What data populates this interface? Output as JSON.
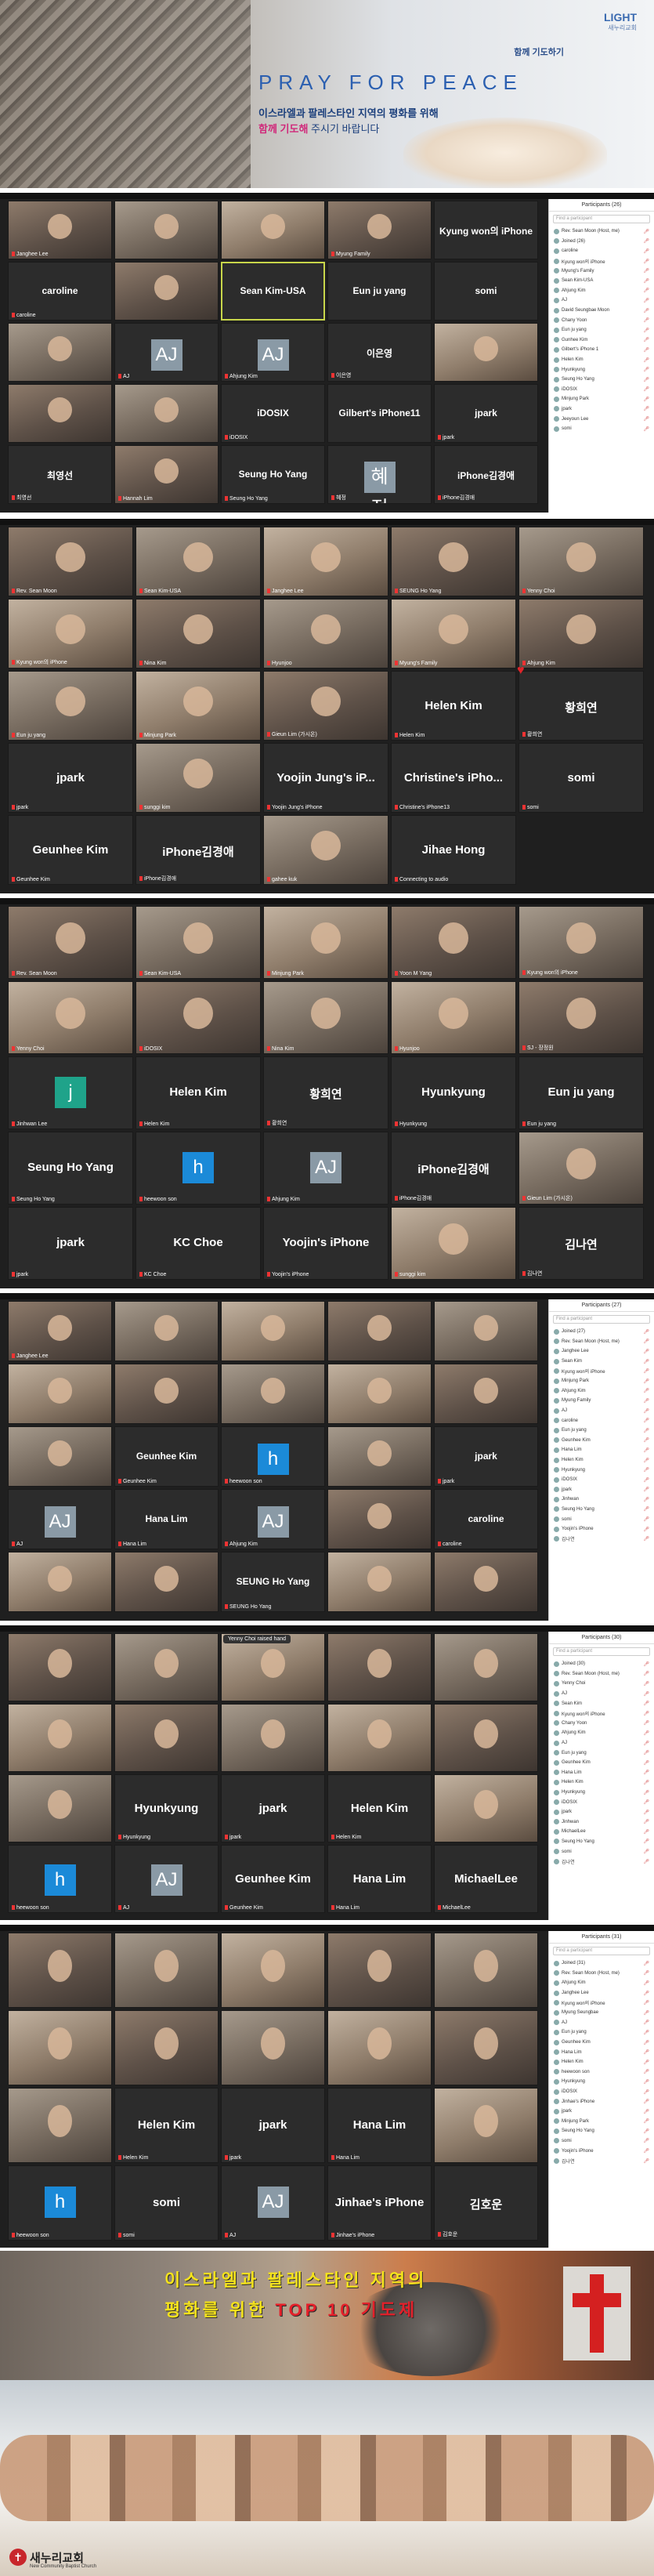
{
  "banner": {
    "logo": "LIGHT",
    "logo_sub": "새누리교회",
    "pray_together": "함께 기도하기",
    "title_pre": "PRAY FOR ",
    "title_word": "PEACE",
    "subtitle1": "이스라엘과 팔레스타인 지역의 평화를 위해",
    "subtitle2_highlight": "함께 기도해",
    "subtitle2_rest": " 주시기 바랍니다"
  },
  "screen1": {
    "tiles": [
      {
        "name": "Janghee Lee",
        "big": ""
      },
      {
        "name": "",
        "big": ""
      },
      {
        "name": "",
        "big": ""
      },
      {
        "name": "Myung Family",
        "big": ""
      },
      {
        "name": "",
        "big": "Kyung won의 iPhone"
      },
      {
        "name": "caroline",
        "big": "caroline"
      },
      {
        "name": "",
        "big": ""
      },
      {
        "name": "",
        "big": "Sean Kim-USA"
      },
      {
        "name": "",
        "big": "Eun ju yang"
      },
      {
        "name": "",
        "big": "somi"
      },
      {
        "name": "",
        "big": ""
      },
      {
        "name": "AJ",
        "big": "AJ"
      },
      {
        "name": "Ahjung Kim",
        "big": "AJ"
      },
      {
        "name": "이은영",
        "big": "이은영"
      },
      {
        "name": "",
        "big": ""
      },
      {
        "name": "",
        "big": ""
      },
      {
        "name": "",
        "big": ""
      },
      {
        "name": "iDOSIX",
        "big": "iDOSIX"
      },
      {
        "name": "",
        "big": "Gilbert's iPhone11"
      },
      {
        "name": "jpark",
        "big": "jpark"
      },
      {
        "name": "최영선",
        "big": "최영선"
      },
      {
        "name": "Hannah Lim",
        "big": ""
      },
      {
        "name": "Seung Ho Yang",
        "big": "Seung Ho Yang"
      },
      {
        "name": "혜정",
        "big": "혜정"
      },
      {
        "name": "iPhone김경애",
        "big": "iPhone김경애"
      }
    ],
    "panel_title": "Participants (26)",
    "search": "Find a participant",
    "participants": [
      "Rev. Sean Moon (Host, me)",
      "Joined (26)",
      "caroline",
      "Kyung won의 iPhone",
      "Myung's Family",
      "Sean Kim-USA",
      "Ahjung Kim",
      "AJ",
      "David Seungbae Moon",
      "Chany Yoon",
      "Eun ju yang",
      "Gunhee Kim",
      "Gilbert's iPhone 1",
      "Helen Kim",
      "Hyunkyung",
      "Seung Ho Yang",
      "iDOSIX",
      "Minjung Park",
      "jpark",
      "Jeeyoun Lee",
      "somi"
    ]
  },
  "screen2": {
    "tiles": [
      {
        "name": "Rev. Sean Moon",
        "big": ""
      },
      {
        "name": "Sean Kim-USA",
        "big": ""
      },
      {
        "name": "Janghee Lee",
        "big": ""
      },
      {
        "name": "SEUNG Ho Yang",
        "big": ""
      },
      {
        "name": "Yenny Choi",
        "big": ""
      },
      {
        "name": "Kyung won의 iPhone",
        "big": ""
      },
      {
        "name": "Nina Kim",
        "big": ""
      },
      {
        "name": "Hyunjoo",
        "big": ""
      },
      {
        "name": "Myung's Family",
        "big": ""
      },
      {
        "name": "Ahjung Kim",
        "big": ""
      },
      {
        "name": "Eun ju yang",
        "big": ""
      },
      {
        "name": "Minjung Park",
        "big": ""
      },
      {
        "name": "Gieun Lim (가시온)",
        "big": ""
      },
      {
        "name": "Helen Kim",
        "big": "Helen Kim"
      },
      {
        "name": "황희연",
        "big": "황희연"
      },
      {
        "name": "jpark",
        "big": "jpark"
      },
      {
        "name": "sunggi kim",
        "big": ""
      },
      {
        "name": "Yoojin Jung's iPhone",
        "big": "Yoojin Jung's iP..."
      },
      {
        "name": "Christine's iPhone13",
        "big": "Christine's iPho..."
      },
      {
        "name": "somi",
        "big": "somi"
      },
      {
        "name": "Geunhee Kim",
        "big": "Geunhee Kim"
      },
      {
        "name": "iPhone김경애",
        "big": "iPhone김경애"
      },
      {
        "name": "gahee kuk",
        "big": ""
      },
      {
        "name": "Connecting to audio",
        "big": "Jihae Hong"
      }
    ]
  },
  "screen3": {
    "tiles": [
      {
        "name": "Rev. Sean Moon",
        "big": ""
      },
      {
        "name": "Sean Kim-USA",
        "big": ""
      },
      {
        "name": "Minjung Park",
        "big": ""
      },
      {
        "name": "Yoon M Yang",
        "big": ""
      },
      {
        "name": "Kyung won의 iPhone",
        "big": ""
      },
      {
        "name": "Yenny Choi",
        "big": ""
      },
      {
        "name": "iDOSIX",
        "big": ""
      },
      {
        "name": "Nina Kim",
        "big": ""
      },
      {
        "name": "Hyunjoo",
        "big": ""
      },
      {
        "name": "SJ - 장정원",
        "big": ""
      },
      {
        "name": "Jinhwan Lee",
        "big": "j"
      },
      {
        "name": "Helen Kim",
        "big": "Helen Kim"
      },
      {
        "name": "황희연",
        "big": "황희연"
      },
      {
        "name": "Hyunkyung",
        "big": "Hyunkyung"
      },
      {
        "name": "Eun ju yang",
        "big": "Eun ju yang"
      },
      {
        "name": "Seung Ho Yang",
        "big": "Seung Ho Yang"
      },
      {
        "name": "heewoon son",
        "big": "h"
      },
      {
        "name": "Ahjung Kim",
        "big": "AJ"
      },
      {
        "name": "iPhone김경애",
        "big": "iPhone김경애"
      },
      {
        "name": "Gieun Lim (가시온)",
        "big": ""
      },
      {
        "name": "jpark",
        "big": "jpark"
      },
      {
        "name": "KC Choe",
        "big": "KC Choe"
      },
      {
        "name": "Yoojin's iPhone",
        "big": "Yoojin's iPhone"
      },
      {
        "name": "sunggi kim",
        "big": ""
      },
      {
        "name": "김나연",
        "big": "김나연"
      }
    ]
  },
  "screen4": {
    "tiles": [
      {
        "name": "Janghee Lee",
        "big": ""
      },
      {
        "name": "",
        "big": ""
      },
      {
        "name": "",
        "big": ""
      },
      {
        "name": "",
        "big": ""
      },
      {
        "name": "",
        "big": ""
      },
      {
        "name": "",
        "big": ""
      },
      {
        "name": "",
        "big": ""
      },
      {
        "name": "",
        "big": ""
      },
      {
        "name": "",
        "big": ""
      },
      {
        "name": "",
        "big": ""
      },
      {
        "name": "",
        "big": ""
      },
      {
        "name": "Geunhee Kim",
        "big": "Geunhee Kim"
      },
      {
        "name": "heewoon son",
        "big": "h"
      },
      {
        "name": "",
        "big": ""
      },
      {
        "name": "jpark",
        "big": "jpark"
      },
      {
        "name": "AJ",
        "big": "AJ"
      },
      {
        "name": "Hana Lim",
        "big": "Hana Lim"
      },
      {
        "name": "Ahjung Kim",
        "big": "AJ"
      },
      {
        "name": "",
        "big": ""
      },
      {
        "name": "caroline",
        "big": "caroline"
      },
      {
        "name": "",
        "big": ""
      },
      {
        "name": "",
        "big": ""
      },
      {
        "name": "SEUNG Ho Yang",
        "big": "SEUNG Ho Yang"
      },
      {
        "name": "",
        "big": ""
      },
      {
        "name": "",
        "big": ""
      }
    ],
    "panel_title": "Participants (27)",
    "search": "Find a participant",
    "participants": [
      "Joined (27)",
      "Rev. Sean Moon (Host, me)",
      "Janghee Lee",
      "Sean Kim",
      "Kyung won의 iPhone",
      "Minjung Park",
      "Ahjung Kim",
      "Myung Family",
      "AJ",
      "caroline",
      "Eun ju yang",
      "Geunhee Kim",
      "Hana Lim",
      "Helen Kim",
      "Hyunkyung",
      "iDOSIX",
      "jpark",
      "Jinhwan",
      "Seung Ho Yang",
      "somi",
      "Yoojin's iPhone",
      "김나연"
    ]
  },
  "screen5": {
    "banner": "Yenny Choi raised hand",
    "tiles": [
      {
        "name": "",
        "big": ""
      },
      {
        "name": "",
        "big": ""
      },
      {
        "name": "",
        "big": ""
      },
      {
        "name": "",
        "big": ""
      },
      {
        "name": "",
        "big": ""
      },
      {
        "name": "",
        "big": ""
      },
      {
        "name": "",
        "big": ""
      },
      {
        "name": "",
        "big": ""
      },
      {
        "name": "",
        "big": ""
      },
      {
        "name": "",
        "big": ""
      },
      {
        "name": "",
        "big": ""
      },
      {
        "name": "Hyunkyung",
        "big": "Hyunkyung"
      },
      {
        "name": "jpark",
        "big": "jpark"
      },
      {
        "name": "Helen Kim",
        "big": "Helen Kim"
      },
      {
        "name": "",
        "big": ""
      },
      {
        "name": "heewoon son",
        "big": "h"
      },
      {
        "name": "AJ",
        "big": "AJ"
      },
      {
        "name": "Geunhee Kim",
        "big": "Geunhee Kim"
      },
      {
        "name": "Hana Lim",
        "big": "Hana Lim"
      },
      {
        "name": "MichaelLee",
        "big": "MichaelLee"
      }
    ],
    "panel_title": "Participants (30)",
    "search": "Find a participant",
    "participants": [
      "Joined (30)",
      "Rev. Sean Moon (Host, me)",
      "Yenny Choi",
      "AJ",
      "Sean Kim",
      "Kyung won의 iPhone",
      "Chany Yoon",
      "Ahjung Kim",
      "AJ",
      "Eun ju yang",
      "Geunhee Kim",
      "Hana Lim",
      "Helen Kim",
      "Hyunkyung",
      "iDOSIX",
      "jpark",
      "Jinhwan",
      "MichaelLee",
      "Seung Ho Yang",
      "somi",
      "김나연"
    ]
  },
  "screen6": {
    "tiles": [
      {
        "name": "",
        "big": ""
      },
      {
        "name": "",
        "big": ""
      },
      {
        "name": "",
        "big": ""
      },
      {
        "name": "",
        "big": ""
      },
      {
        "name": "",
        "big": ""
      },
      {
        "name": "",
        "big": ""
      },
      {
        "name": "",
        "big": ""
      },
      {
        "name": "",
        "big": ""
      },
      {
        "name": "",
        "big": ""
      },
      {
        "name": "",
        "big": ""
      },
      {
        "name": "",
        "big": ""
      },
      {
        "name": "Helen Kim",
        "big": "Helen Kim"
      },
      {
        "name": "jpark",
        "big": "jpark"
      },
      {
        "name": "Hana Lim",
        "big": "Hana Lim"
      },
      {
        "name": "",
        "big": ""
      },
      {
        "name": "heewoon son",
        "big": "h"
      },
      {
        "name": "somi",
        "big": "somi"
      },
      {
        "name": "AJ",
        "big": "AJ"
      },
      {
        "name": "Jinhae's iPhone",
        "big": "Jinhae's iPhone"
      },
      {
        "name": "김호운",
        "big": "김호운"
      }
    ],
    "panel_title": "Participants (31)",
    "search": "Find a participant",
    "participants": [
      "Joined (31)",
      "Rev. Sean Moon (Host, me)",
      "Ahjung Kim",
      "Janghee Lee",
      "Kyung won의 iPhone",
      "Myung Seungbae",
      "AJ",
      "Eun ju yang",
      "Geunhee Kim",
      "Hana Lim",
      "Helen Kim",
      "heewoon son",
      "Hyunkyung",
      "iDOSIX",
      "Jinhae's iPhone",
      "jpark",
      "Minjung Park",
      "Seung Ho Yang",
      "somi",
      "Yoojin's iPhone",
      "김나연"
    ]
  },
  "bottom": {
    "line1": "이스라엘과 팔레스타인 지역의",
    "line2_pre": "평화를 위한 ",
    "line2_highlight": "TOP 10 기도제",
    "church": "새누리교회",
    "church_sub": "New Community Baptist Church"
  }
}
